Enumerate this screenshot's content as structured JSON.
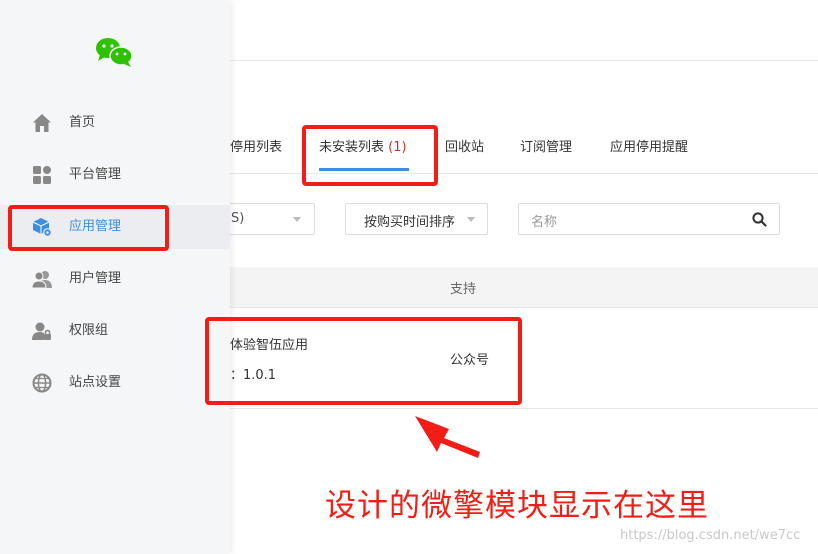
{
  "sidebar": {
    "items": [
      {
        "label": "首页",
        "icon": "home-icon"
      },
      {
        "label": "平台管理",
        "icon": "grid-icon"
      },
      {
        "label": "应用管理",
        "icon": "app-cube-icon"
      },
      {
        "label": "用户管理",
        "icon": "users-icon"
      },
      {
        "label": "权限组",
        "icon": "user-lock-icon"
      },
      {
        "label": "站点设置",
        "icon": "globe-icon"
      }
    ],
    "active_index": 2
  },
  "tabs": [
    {
      "label": "停用列表"
    },
    {
      "label": "未安装列表",
      "count": "(1)"
    },
    {
      "label": "回收站"
    },
    {
      "label": "订阅管理"
    },
    {
      "label": "应用停用提醒"
    }
  ],
  "filters": {
    "first_select_partial": "S)",
    "sort_select": "按购买时间排序",
    "search_placeholder": "名称"
  },
  "table": {
    "header_support": "支持",
    "rows": [
      {
        "name": "体验智伍应用",
        "version": "：1.0.1",
        "support": "公众号"
      }
    ]
  },
  "annotation": "设计的微擎模块显示在这里",
  "watermark": "https://blog.csdn.net/we7cc",
  "colors": {
    "accent": "#3d8ee0",
    "highlight": "#f21d14",
    "logo": "#2dc100"
  }
}
